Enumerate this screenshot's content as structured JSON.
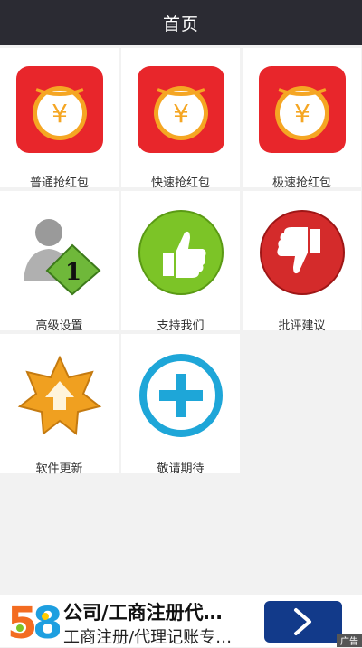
{
  "header": {
    "title": "首页"
  },
  "tiles": [
    {
      "label": "普通抢红包",
      "icon": "red-envelope-icon"
    },
    {
      "label": "快速抢红包",
      "icon": "red-envelope-icon"
    },
    {
      "label": "极速抢红包",
      "icon": "red-envelope-icon"
    },
    {
      "label": "高级设置",
      "icon": "user-settings-icon"
    },
    {
      "label": "支持我们",
      "icon": "thumbs-up-icon"
    },
    {
      "label": "批评建议",
      "icon": "thumbs-down-icon"
    },
    {
      "label": "软件更新",
      "icon": "update-icon"
    },
    {
      "label": "敬请期待",
      "icon": "plus-icon"
    }
  ],
  "ad": {
    "logo_text": "58",
    "title": "公司/工商注册代…",
    "subtitle": "工商注册/代理记账专…",
    "tag": "广告"
  },
  "colors": {
    "header_bg": "#2b2b33",
    "envelope_red": "#e8262b",
    "coin_gold": "#f5a623",
    "ad_button": "#123a8a"
  }
}
